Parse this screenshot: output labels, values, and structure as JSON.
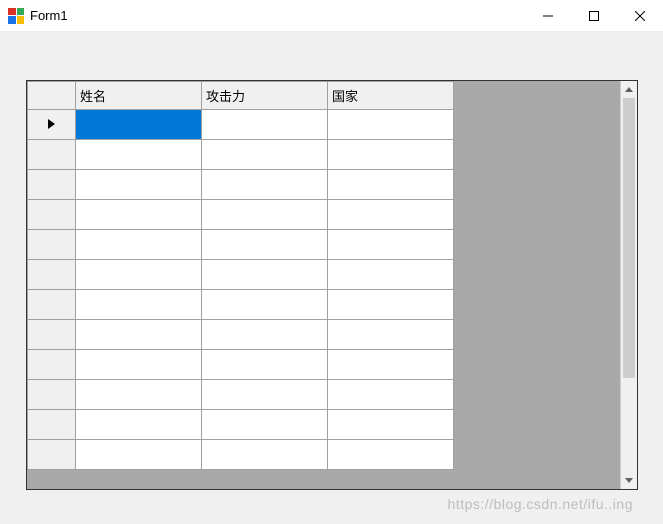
{
  "window": {
    "title": "Form1"
  },
  "grid": {
    "columns": [
      "姓名",
      "攻击力",
      "国家"
    ],
    "rowCount": 12,
    "currentRow": 0,
    "selectedCell": {
      "row": 0,
      "col": 0
    }
  },
  "watermark": "https://blog.csdn.net/ifu..ing"
}
